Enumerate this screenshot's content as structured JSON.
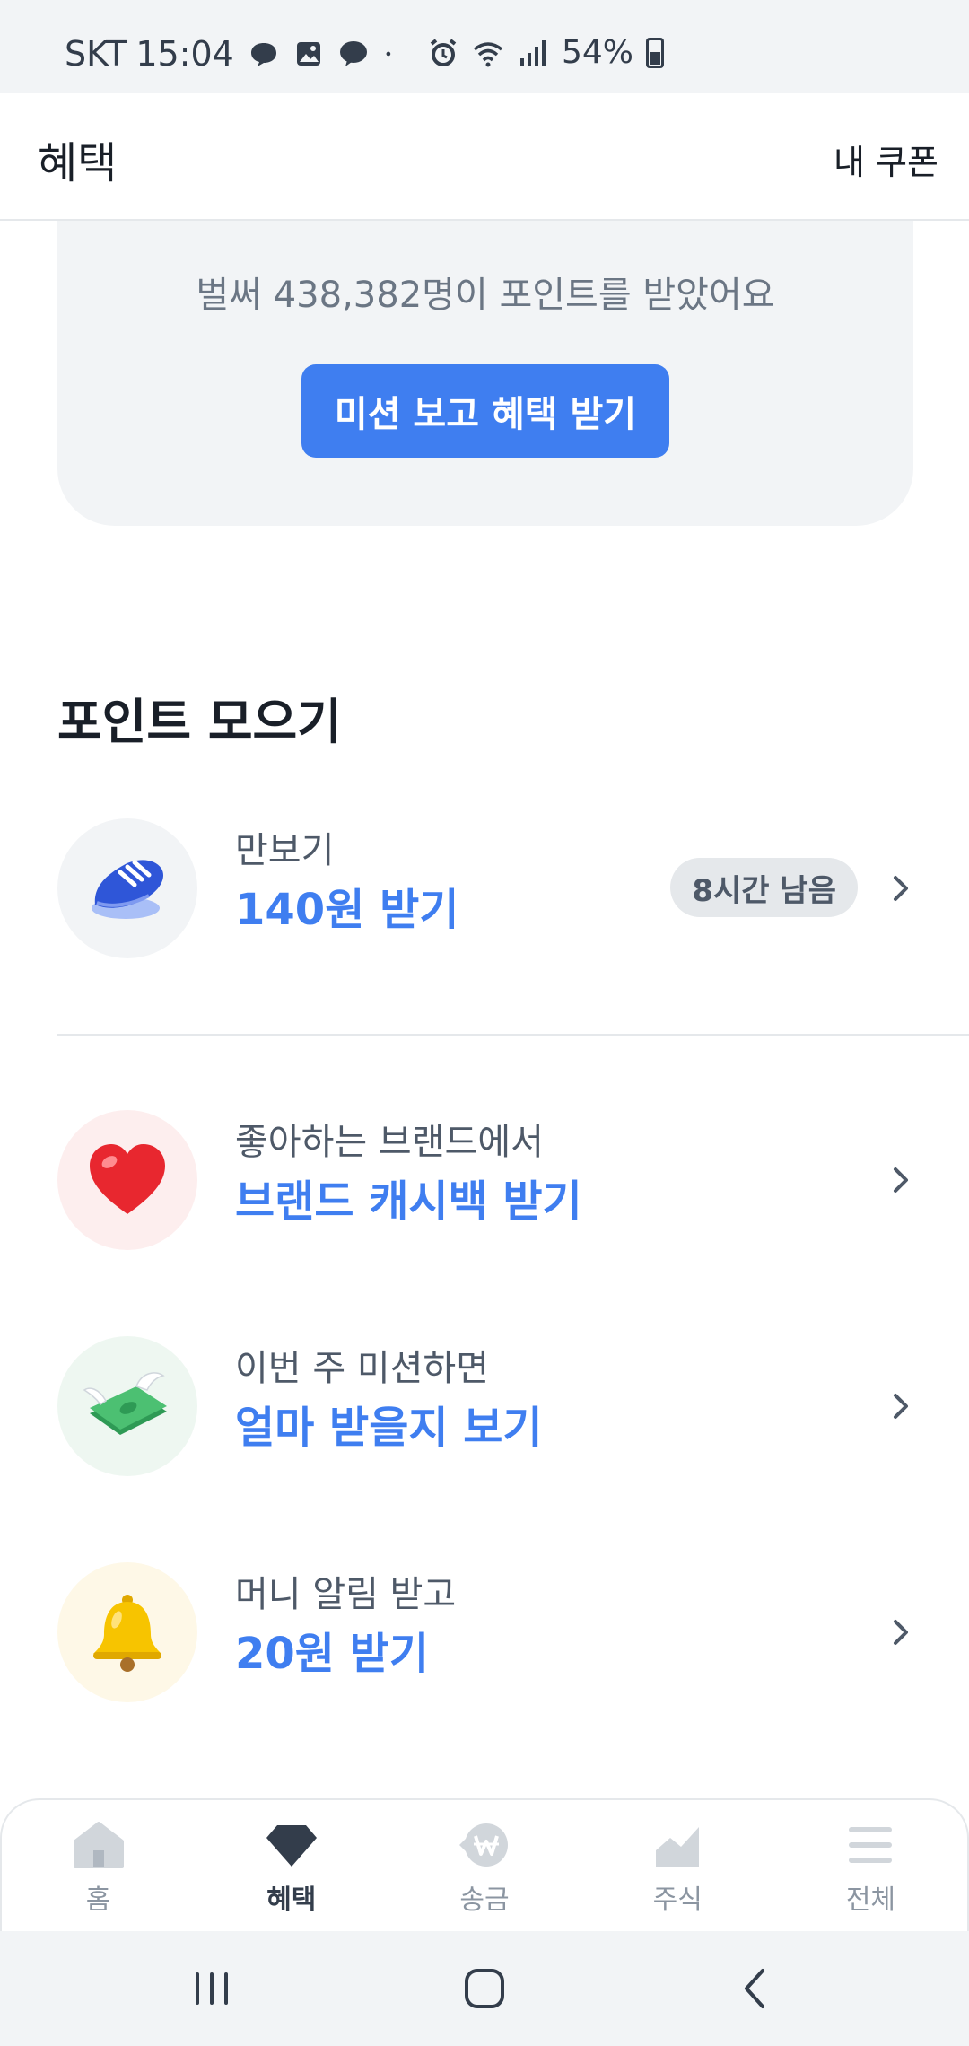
{
  "status_bar": {
    "carrier": "SKT",
    "time": "15:04",
    "battery": "54%",
    "icons": [
      "message-icon",
      "gallery-icon",
      "kakaotalk-icon",
      "dot-icon",
      "alarm-icon",
      "wifi-icon",
      "signal-icon",
      "battery-icon"
    ]
  },
  "header": {
    "title": "혜택",
    "coupon_link": "내 쿠폰"
  },
  "mission_card": {
    "subtitle": "벌써 438,382명이 포인트를 받았어요",
    "button_label": "미션 보고 혜택 받기"
  },
  "points_section": {
    "title": "포인트 모으기",
    "items": [
      {
        "icon": "sneaker-icon",
        "sub": "만보기",
        "main": "140원 받기",
        "badge": "8시간 남음",
        "bg": "#f2f4f6"
      },
      {
        "icon": "heart-icon",
        "sub": "좋아하는 브랜드에서",
        "main": "브랜드 캐시백 받기",
        "bg": "#fdeeee"
      },
      {
        "icon": "winged-money-icon",
        "sub": "이번 주 미션하면",
        "main": "얼마 받을지 보기",
        "bg": "#eef7f1"
      },
      {
        "icon": "bell-icon",
        "sub": "머니 알림 받고",
        "main": "20원 받기",
        "bg": "#fef8e7"
      }
    ]
  },
  "bottom_nav": {
    "items": [
      {
        "label": "홈",
        "icon": "home-icon"
      },
      {
        "label": "혜택",
        "icon": "diamond-icon",
        "active": true
      },
      {
        "label": "송금",
        "icon": "won-transfer-icon"
      },
      {
        "label": "주식",
        "icon": "stock-chart-icon"
      },
      {
        "label": "전체",
        "icon": "menu-icon"
      }
    ]
  },
  "colors": {
    "accent": "#3f7ef0",
    "text_primary": "#191f28",
    "text_secondary": "#4e5968",
    "nav_inactive": "#8b95a1",
    "background_gray": "#f2f4f6"
  }
}
